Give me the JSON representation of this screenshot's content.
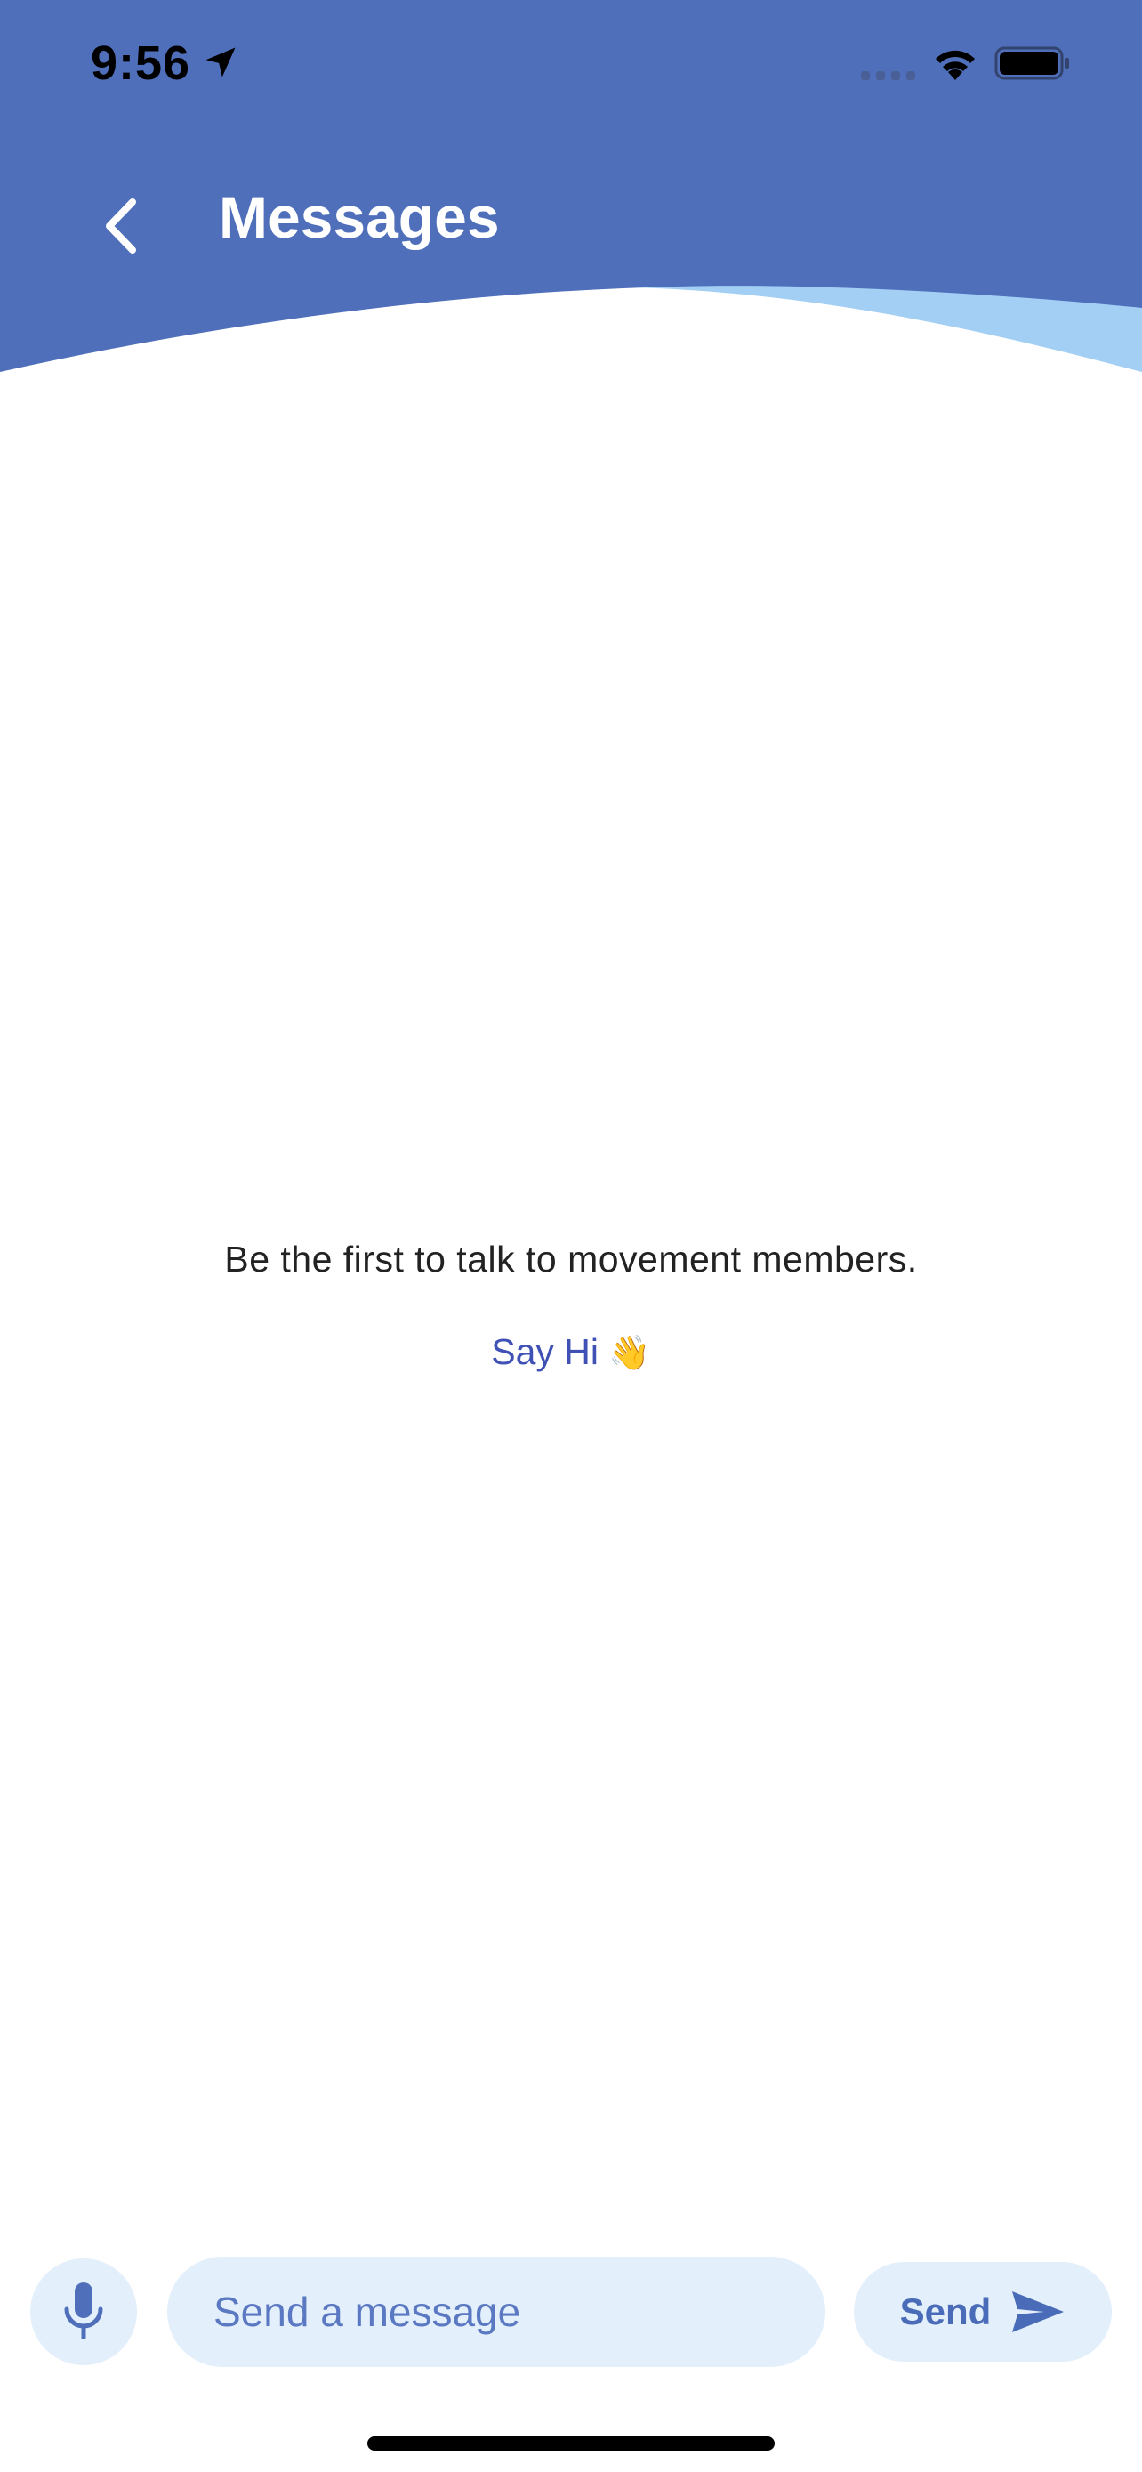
{
  "status_bar": {
    "time": "9:56"
  },
  "header": {
    "title": "Messages"
  },
  "empty_state": {
    "message": "Be the first to talk to movement members.",
    "say_hi_label": "Say Hi",
    "say_hi_emoji": "👋"
  },
  "composer": {
    "input_placeholder": "Send a message",
    "input_value": "",
    "send_label": "Send"
  },
  "colors": {
    "header_primary": "#4f6fbb",
    "header_wave": "#a3cff5",
    "accent": "#3f51b5",
    "composer_bg": "#e3effb"
  },
  "icons": {
    "back": "chevron-left-icon",
    "location": "location-arrow-icon",
    "wifi": "wifi-icon",
    "battery": "battery-icon",
    "cellular": "cellular-signal-icon",
    "mic": "microphone-icon",
    "send": "paper-plane-icon"
  }
}
